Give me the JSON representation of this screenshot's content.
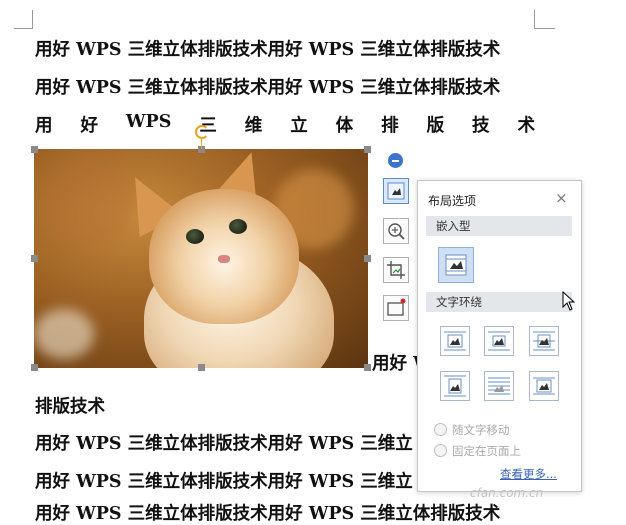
{
  "document": {
    "line1": "用好 WPS 三维立体排版技术用好 WPS 三维立体排版技术",
    "line2": "用好 WPS 三维立体排版技术用好 WPS 三维立体排版技术",
    "line3_chars": [
      "用",
      "好",
      "WPS",
      "三",
      "维",
      "立",
      "体",
      "排",
      "版",
      "技",
      "术"
    ],
    "right_of_image": "用好 W",
    "line4": "排版技术",
    "line5": "用好 WPS 三维立体排版技术用好 WPS 三维立",
    "line6": "用好 WPS 三维立体排版技术用好 WPS 三维立",
    "line7": "用好 WPS 三维立体排版技术用好 WPS 三维立体排版技术"
  },
  "image_toolbar": {
    "collapse_icon": "minus-circle-icon",
    "layout_icon": "layout-options-icon",
    "zoom_icon": "zoom-in-icon",
    "crop_icon": "crop-icon",
    "border_icon": "image-border-icon"
  },
  "layout_panel": {
    "title": "布局选项",
    "close": "×",
    "inline_section": "嵌入型",
    "wrap_section": "文字环绕",
    "move_with_text": "随文字移动",
    "fix_on_page": "固定在页面上",
    "more_link": "查看更多..."
  },
  "watermark": "cfan.com.cn",
  "colors": {
    "accent": "#3c74c8",
    "link": "#3a63b8",
    "rotate_handle": "#f0a020",
    "section_bg": "#e3e6ea"
  }
}
